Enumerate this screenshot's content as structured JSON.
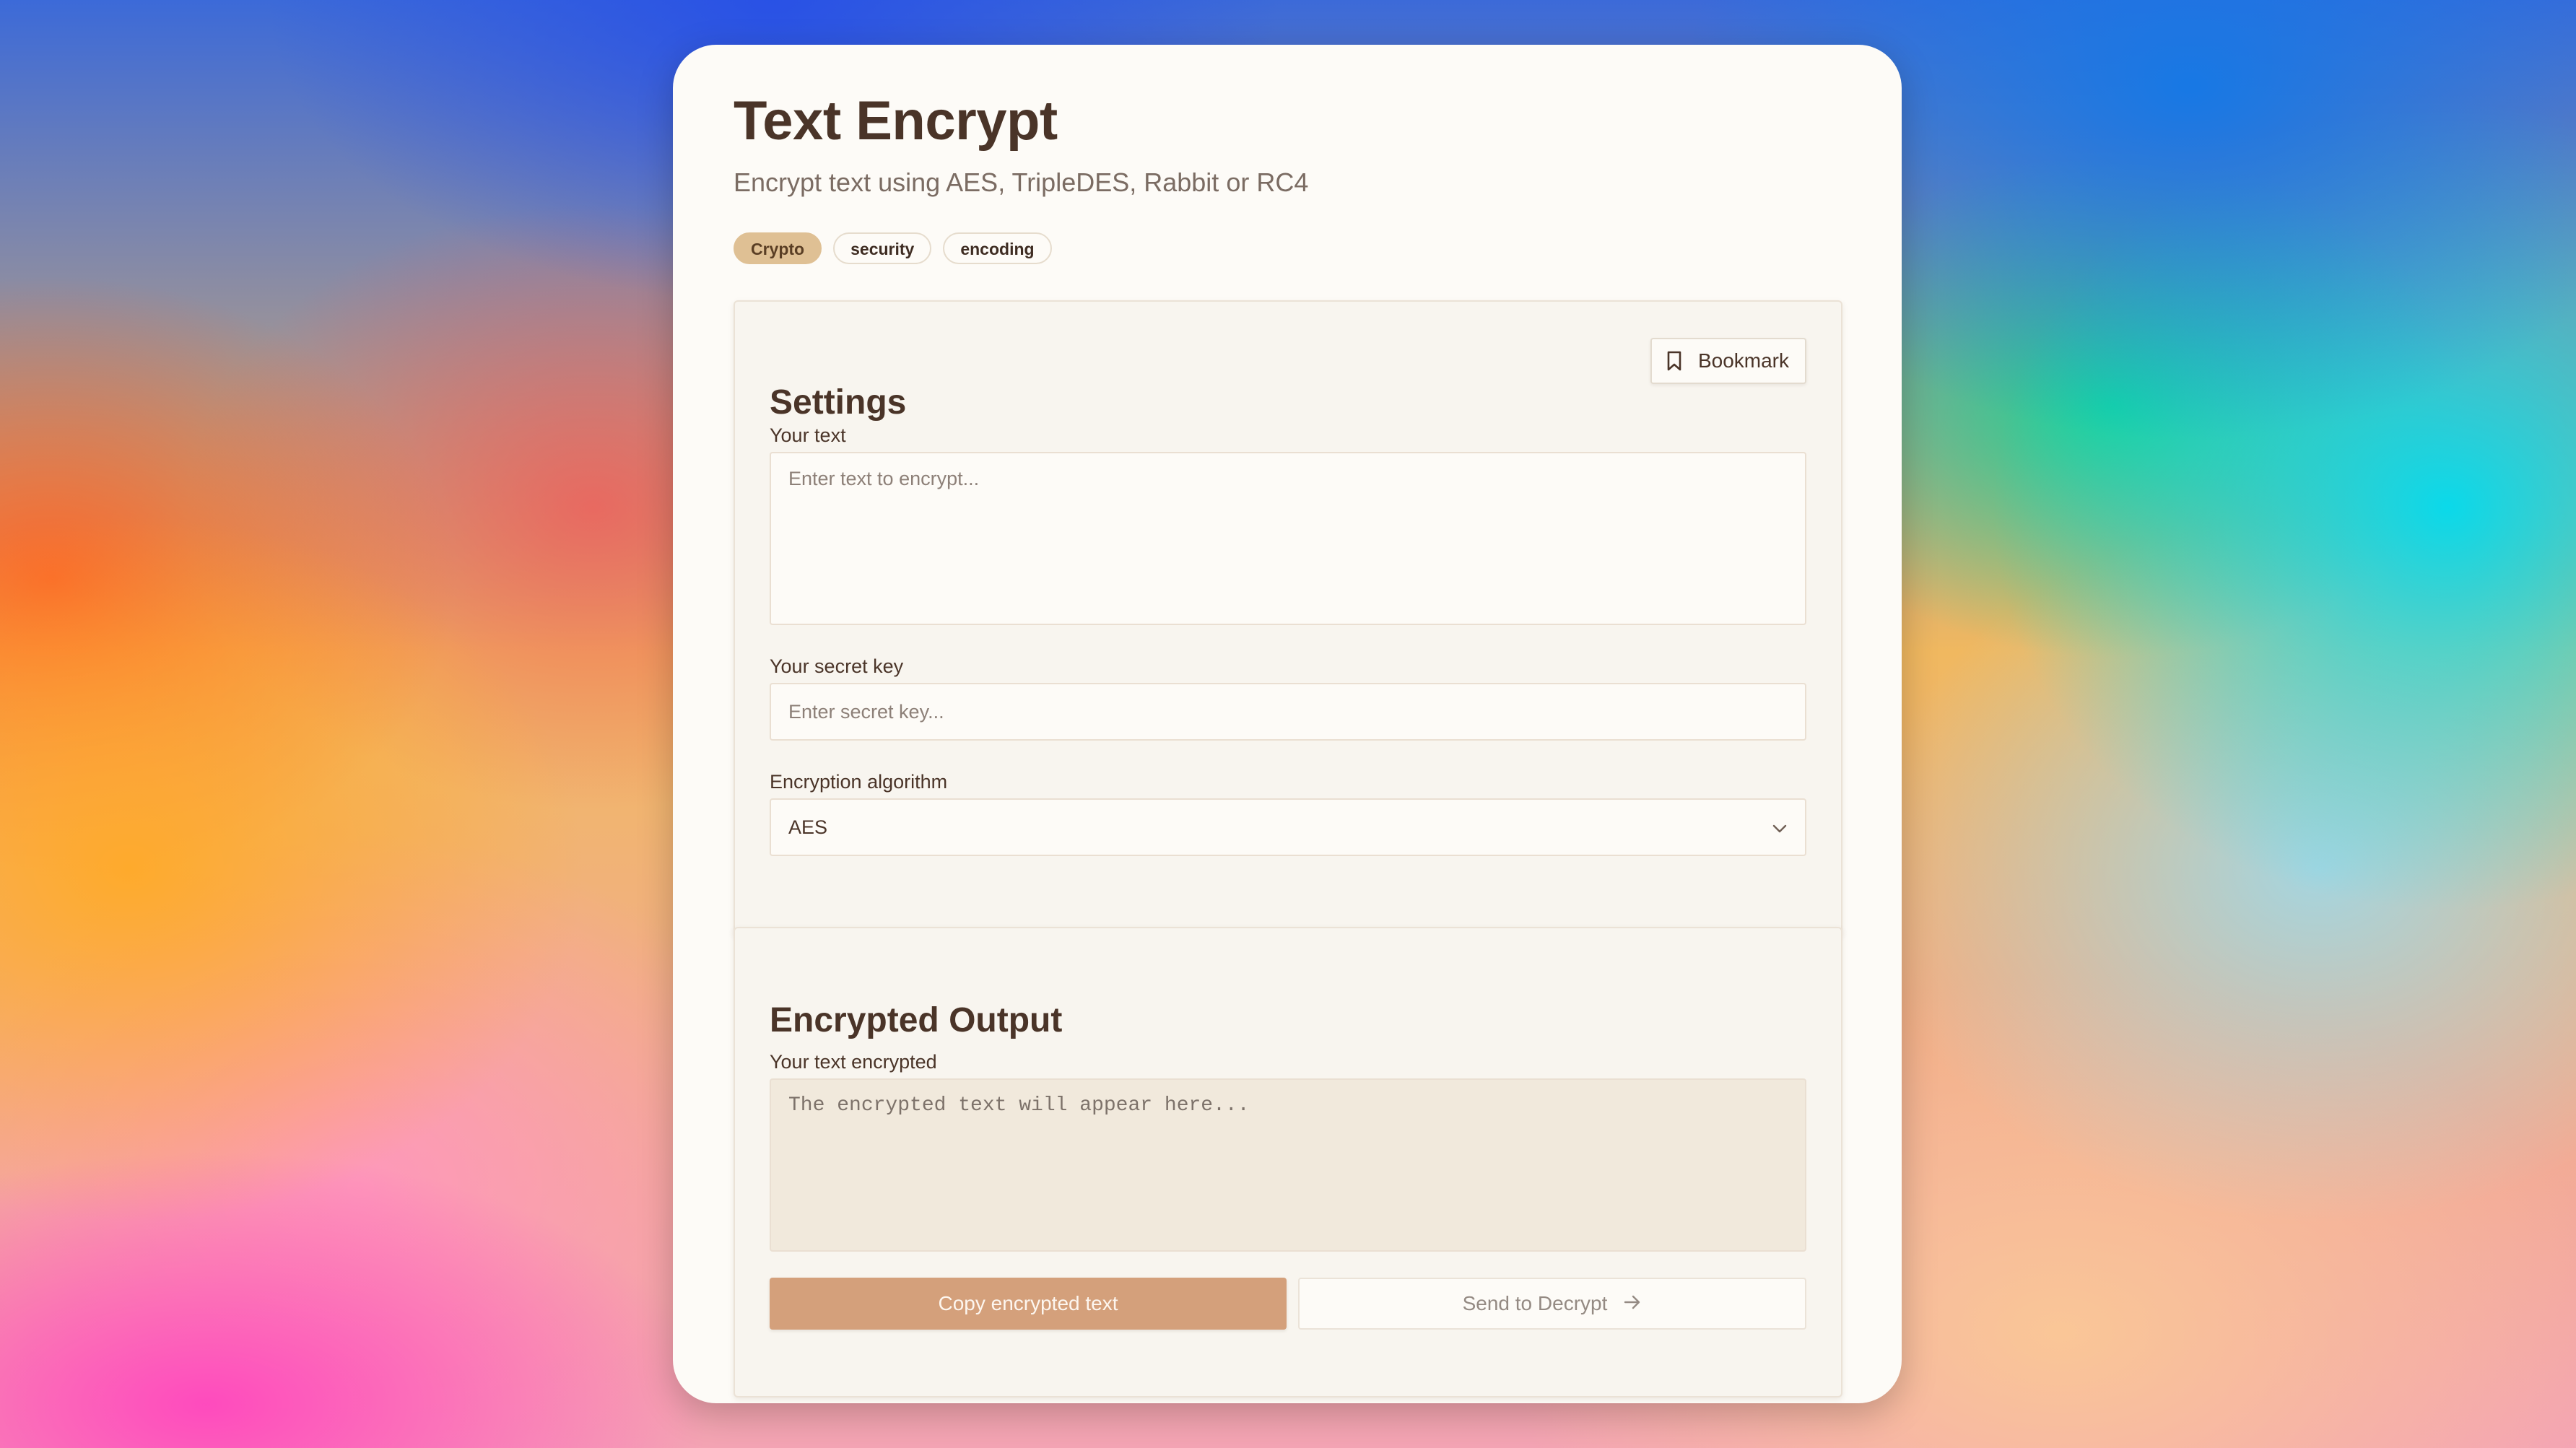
{
  "app": {
    "title": "Text Encrypt",
    "subtitle": "Encrypt text using AES, TripleDES, Rabbit or RC4",
    "tags": [
      "Crypto",
      "security",
      "encoding"
    ]
  },
  "settings": {
    "title": "Settings",
    "bookmark_label": "Bookmark",
    "text_label": "Your text",
    "text_placeholder": "Enter text to encrypt...",
    "text_value": "",
    "key_label": "Your secret key",
    "key_placeholder": "Enter secret key...",
    "key_value": "",
    "algorithm_label": "Encryption algorithm",
    "algorithm_selected": "AES"
  },
  "output": {
    "title": "Encrypted Output",
    "label": "Your text encrypted",
    "placeholder": "The encrypted text will appear here...",
    "value": "",
    "copy_label": "Copy encrypted text",
    "send_label": "Send to Decrypt"
  },
  "icons": {
    "bookmark": "bookmark-icon",
    "chevron": "chevron-down-icon",
    "arrow": "arrow-right-icon"
  },
  "colors": {
    "accent": "#d4a07b",
    "tag_primary": "#dfc094",
    "heading": "#4a3428",
    "card_bg": "#fdfbf7"
  }
}
